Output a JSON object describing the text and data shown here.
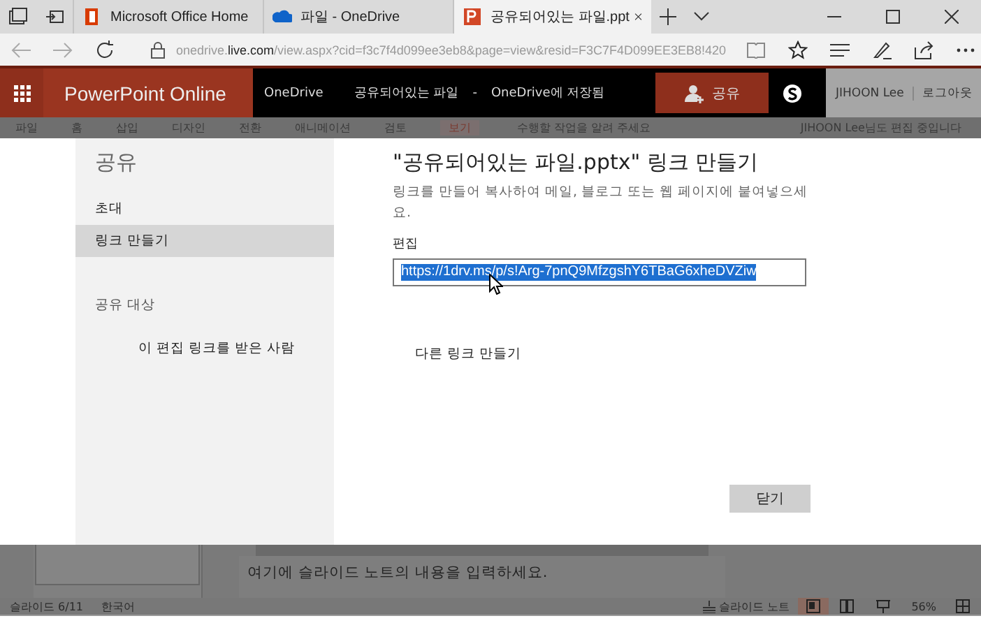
{
  "browser": {
    "tabs": [
      {
        "title": "Microsoft Office Home",
        "selected": false,
        "kind": "office"
      },
      {
        "title": "파일 - OneDrive",
        "selected": false,
        "kind": "cloud"
      },
      {
        "title": "공유되어있는 파일.ppt",
        "selected": true,
        "kind": "powerpoint"
      }
    ],
    "address": "onedrive.**live.com**/view.aspx?cid=f3c7f4d099ee3eb8&page=view&resid=F3C7F4D099EE3EB8!420"
  },
  "app": {
    "name": "PowerPoint Online",
    "location": "OneDrive",
    "file": "공유되어있는 파일",
    "separator": "-",
    "save_status": "OneDrive에 저장됨",
    "share_button": "공유",
    "user": "JIHOON Lee",
    "sign_out": "로그아웃"
  },
  "ribbon": {
    "tabs": [
      {
        "label": "파일",
        "selected": false
      },
      {
        "label": "홈",
        "selected": false
      },
      {
        "label": "삽입",
        "selected": false
      },
      {
        "label": "디자인",
        "selected": false
      },
      {
        "label": "전환",
        "selected": false
      },
      {
        "label": "애니메이션",
        "selected": false
      },
      {
        "label": "검토",
        "selected": false
      },
      {
        "label": "보기",
        "selected": true
      }
    ],
    "tell_me": "수행할 작업을 알려 주세요",
    "coauthor": "JIHOON Lee님도 편집 중입니다"
  },
  "dialog": {
    "sidebar": {
      "title": "공유",
      "items": [
        {
          "label": "초대",
          "selected": false
        },
        {
          "label": "링크 만들기",
          "selected": true
        }
      ],
      "section": "공유 대상",
      "recipient": "이 편집 링크를 받은 사람"
    },
    "title": "\"공유되어있는 파일.pptx\" 링크 만들기",
    "description": "링크를 만들어 복사하여 메일, 블로그 또는 웹 페이지에 붙여넣으세요.",
    "field_label": "편집",
    "link": "https://1drv.ms/p/s!Arg-7pnQ9MfzgshY6TBaG6xheDVZiw",
    "another_link": "다른 링크 만들기",
    "close_button": "닫기"
  },
  "notes": {
    "placeholder": "여기에 슬라이드 노트의 내용을 입력하세요."
  },
  "status_bar": {
    "slide": "슬라이드 6/11",
    "language": "한국어",
    "notes_button": "슬라이드 노트",
    "zoom": "56%"
  }
}
